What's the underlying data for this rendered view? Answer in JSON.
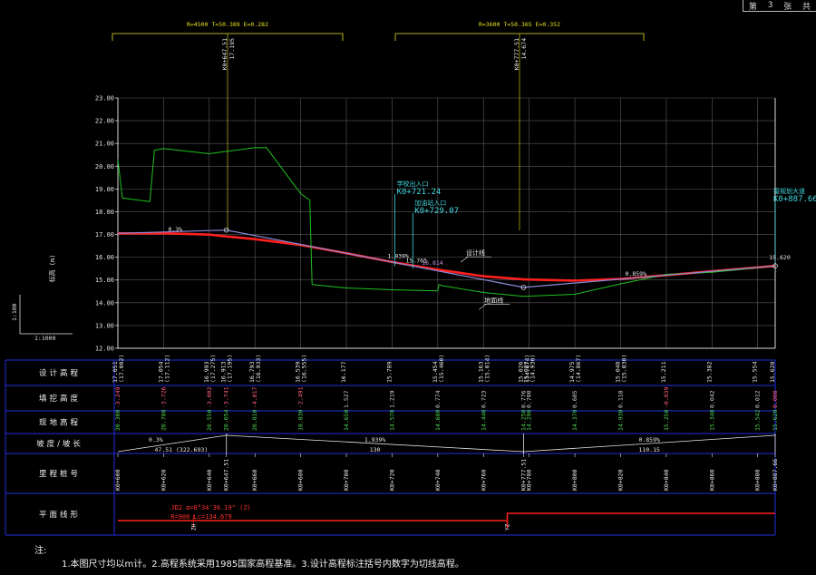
{
  "sheet": {
    "label_pre": "第",
    "num": "3",
    "label_post": "张",
    "extra": "共"
  },
  "curves": [
    {
      "params": "R=4500 T=50.389 E=0.282",
      "station": "K0+647.51",
      "elev": "17.195"
    },
    {
      "params": "R=3600 T=50.365 E=0.352",
      "station": "K0+777.51",
      "elev": "14.674"
    }
  ],
  "profile_axis": {
    "title": "标高 (m)",
    "ticks": [
      "23.00",
      "22.00",
      "21.00",
      "20.00",
      "19.00",
      "18.00",
      "17.00",
      "16.00",
      "15.00",
      "14.00",
      "13.00",
      "12.00"
    ],
    "scale_v": "1:100",
    "scale_h": "1:1000"
  },
  "chart_data": {
    "type": "line",
    "xlabel": "",
    "ylabel": "标高 (m)",
    "ylim": [
      12,
      23
    ],
    "xlim": [
      600,
      887.66
    ],
    "series": [
      {
        "name": "设计线",
        "color": "#ff2020",
        "x": [
          600,
          620,
          640,
          647.51,
          660,
          680,
          700,
          720,
          740,
          760,
          777.51,
          800,
          820,
          840,
          860,
          887.66
        ],
        "y": [
          17.051,
          17.054,
          16.993,
          16.913,
          16.793,
          16.539,
          16.177,
          15.789,
          15.454,
          15.163,
          15.026,
          14.975,
          15.048,
          15.211,
          15.382,
          15.62
        ]
      },
      {
        "name": "地面线",
        "color": "#20c020",
        "x": [
          600,
          602,
          614,
          616,
          620,
          640,
          647.51,
          660,
          665,
          680,
          684,
          685,
          700,
          720,
          740,
          740.5,
          742,
          760,
          777.51,
          780,
          800,
          820,
          840,
          860,
          887.66
        ],
        "y": [
          20.3,
          18.6,
          18.45,
          20.7,
          20.78,
          20.55,
          20.654,
          20.81,
          20.82,
          18.8,
          18.5,
          14.8,
          14.65,
          14.57,
          14.52,
          14.8,
          14.75,
          14.45,
          14.28,
          14.29,
          14.37,
          14.83,
          15.25,
          15.34,
          15.62
        ]
      },
      {
        "name": "坡度线",
        "color": "#8a8ad8",
        "x": [
          600,
          647.51,
          777.51,
          887.66
        ],
        "y": [
          17.051,
          17.195,
          14.674,
          15.62
        ]
      }
    ],
    "slope_labels": [
      {
        "text": "0.3%",
        "x": 622,
        "y": 17.15
      },
      {
        "text": "1.939%",
        "x": 718,
        "y": 15.97
      },
      {
        "text": "0.859%",
        "x": 822,
        "y": 15.18
      }
    ],
    "annotations": [
      {
        "title": "学校出入口",
        "station": "K0+721.24",
        "x": 721.24,
        "elev": "15.765",
        "elev_x": 726,
        "elev_y": 15.76,
        "color": "#40d8e0"
      },
      {
        "title": "加油站入口",
        "station": "K0+729.07",
        "x": 729.07,
        "elev": "16.814",
        "elev_x": 733,
        "elev_y": 15.66,
        "color": "#40d8e0"
      },
      {
        "title": "接规划大道",
        "station": "K0+887.66",
        "x": 887.66,
        "elev": "15.620",
        "elev_x": 885,
        "elev_y": 15.9,
        "color": "#40d8e0"
      }
    ],
    "line_labels": [
      {
        "text": "设计线",
        "x": 750,
        "y": 16.1
      },
      {
        "text": "地面线",
        "x": 758,
        "y": 14.02
      }
    ]
  },
  "table": {
    "row_labels": [
      "设计高程",
      "填挖高度",
      "现地高程",
      "坡度/坡长",
      "里程桩号",
      "平面线形"
    ],
    "design": [
      {
        "x": 600,
        "v": "17.051",
        "s": "(17.002)"
      },
      {
        "x": 620,
        "v": "17.054",
        "s": "(17.112)"
      },
      {
        "x": 640,
        "v": "16.993",
        "s": "(17.275)"
      },
      {
        "x": 647.51,
        "v": "16.913",
        "s": "(17.195)"
      },
      {
        "x": 660,
        "v": "16.793",
        "s": "(16.933)"
      },
      {
        "x": 680,
        "v": "16.539",
        "s": "(16.555)"
      },
      {
        "x": 700,
        "v": "16.177",
        "s": ""
      },
      {
        "x": 720,
        "v": "15.789",
        "s": ""
      },
      {
        "x": 740,
        "v": "15.454",
        "s": "(15.460)"
      },
      {
        "x": 760,
        "v": "15.163",
        "s": "(15.014)"
      },
      {
        "x": 777.51,
        "v": "15.026",
        "s": "(14.674)"
      },
      {
        "x": 780,
        "v": "15.027",
        "s": "(14.930)"
      },
      {
        "x": 800,
        "v": "14.975",
        "s": "(14.867)"
      },
      {
        "x": 820,
        "v": "15.048",
        "s": "(15.030)"
      },
      {
        "x": 840,
        "v": "15.211",
        "s": ""
      },
      {
        "x": 860,
        "v": "15.382",
        "s": ""
      },
      {
        "x": 880,
        "v": "15.554",
        "s": ""
      },
      {
        "x": 887.66,
        "v": "15.620",
        "s": ""
      }
    ],
    "fill": [
      {
        "x": 600,
        "v": "-3.249",
        "c": "#ff6080"
      },
      {
        "x": 620,
        "v": "-3.726",
        "c": "#ff6080"
      },
      {
        "x": 640,
        "v": "-3.002",
        "c": "#ff6080"
      },
      {
        "x": 647.51,
        "v": "-3.741",
        "c": "#ff6080"
      },
      {
        "x": 660,
        "v": "-4.017",
        "c": "#ff6080"
      },
      {
        "x": 680,
        "v": "-2.491",
        "c": "#ff6080"
      },
      {
        "x": 700,
        "v": "1.527",
        "c": "#d0d0d0"
      },
      {
        "x": 720,
        "v": "1.219",
        "c": "#d0d0d0"
      },
      {
        "x": 740,
        "v": "0.774",
        "c": "#d0d0d0"
      },
      {
        "x": 760,
        "v": "0.723",
        "c": "#d0d0d0"
      },
      {
        "x": 777.51,
        "v": "0.776",
        "c": "#d0d0d0"
      },
      {
        "x": 780,
        "v": "0.700",
        "c": "#d0d0d0"
      },
      {
        "x": 800,
        "v": "0.605",
        "c": "#d0d0d0"
      },
      {
        "x": 820,
        "v": "0.118",
        "c": "#d0d0d0"
      },
      {
        "x": 840,
        "v": "-0.039",
        "c": "#ff6080"
      },
      {
        "x": 860,
        "v": "0.042",
        "c": "#d0d0d0"
      },
      {
        "x": 880,
        "v": "0.012",
        "c": "#d0d0d0"
      },
      {
        "x": 887.66,
        "v": "0.000",
        "c": "#ff6080"
      }
    ],
    "ground": [
      {
        "x": 600,
        "v": "20.300"
      },
      {
        "x": 620,
        "v": "20.780"
      },
      {
        "x": 640,
        "v": "20.550"
      },
      {
        "x": 647.51,
        "v": "20.654"
      },
      {
        "x": 660,
        "v": "20.810"
      },
      {
        "x": 680,
        "v": "18.830"
      },
      {
        "x": 700,
        "v": "14.650"
      },
      {
        "x": 720,
        "v": "14.570"
      },
      {
        "x": 740,
        "v": "14.680"
      },
      {
        "x": 760,
        "v": "14.440"
      },
      {
        "x": 777.51,
        "v": "14.250"
      },
      {
        "x": 780,
        "v": "14.290"
      },
      {
        "x": 800,
        "v": "14.370"
      },
      {
        "x": 820,
        "v": "14.930"
      },
      {
        "x": 840,
        "v": "15.250"
      },
      {
        "x": 860,
        "v": "15.340"
      },
      {
        "x": 880,
        "v": "15.542"
      },
      {
        "x": 887.66,
        "v": "15.620"
      }
    ],
    "slopes": [
      {
        "top": "0.3%",
        "bottom": "47.51 (322.693)",
        "x1": 600,
        "x2": 647.51
      },
      {
        "top": "1.939%",
        "bottom": "130",
        "x1": 647.51,
        "x2": 777.51
      },
      {
        "top": "0.859%",
        "bottom": "110.15",
        "x1": 777.51,
        "x2": 887.66
      }
    ],
    "stations": [
      {
        "x": 600,
        "v": "K0+600"
      },
      {
        "x": 620,
        "v": "K0+620"
      },
      {
        "x": 640,
        "v": "K0+640"
      },
      {
        "x": 647.51,
        "v": "K0+647.51"
      },
      {
        "x": 660,
        "v": "K0+660"
      },
      {
        "x": 680,
        "v": "K0+680"
      },
      {
        "x": 700,
        "v": "K0+700"
      },
      {
        "x": 720,
        "v": "K0+720"
      },
      {
        "x": 740,
        "v": "K0+740"
      },
      {
        "x": 760,
        "v": "K0+760"
      },
      {
        "x": 777.51,
        "v": "K0+777.51"
      },
      {
        "x": 780,
        "v": "K0+780"
      },
      {
        "x": 800,
        "v": "K0+800"
      },
      {
        "x": 820,
        "v": "K0+820"
      },
      {
        "x": 840,
        "v": "K0+840"
      },
      {
        "x": 860,
        "v": "K0+860"
      },
      {
        "x": 880,
        "v": "K0+880"
      },
      {
        "x": 887.66,
        "v": "K0+887.66"
      }
    ],
    "plan": {
      "curve_line1": "JD2 α=8°34'36.19\" (Z)",
      "curve_line2": "R=900 Lc=134.679",
      "zh_label": "ZH",
      "hz_label": "YZ",
      "zh_x": 637,
      "hz_x": 772
    }
  },
  "notes": {
    "title": "注:",
    "text": "1.本图尺寸均以m计。2.高程系统采用1985国家高程基准。3.设计高程标注括号内数字为切线高程。"
  }
}
